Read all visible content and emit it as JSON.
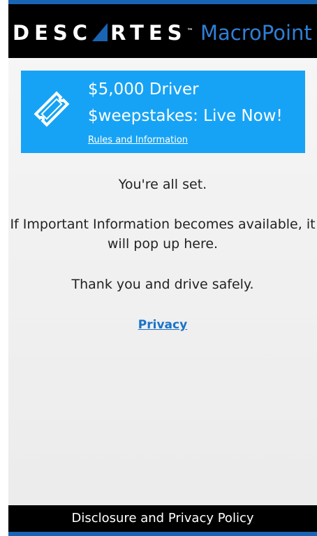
{
  "header": {
    "brand": "DESC",
    "brand_rest": "RTES",
    "trademark": "™",
    "product": "MacroPoint"
  },
  "banner": {
    "title": "$5,000 Driver $weepstakes: Live Now!",
    "link": "Rules and Information",
    "icon": "ticket-icon"
  },
  "content": {
    "status": "You're all set.",
    "info": "If Important Information becomes available, it will pop up here.",
    "thanks": "Thank you and drive safely.",
    "privacy_link": "Privacy"
  },
  "footer": {
    "label": "Disclosure and Privacy Policy"
  },
  "colors": {
    "accent_blue": "#17a3f5",
    "brand_blue": "#2f7fd6",
    "link_blue": "#1b72c7",
    "header_bg": "#000000"
  }
}
